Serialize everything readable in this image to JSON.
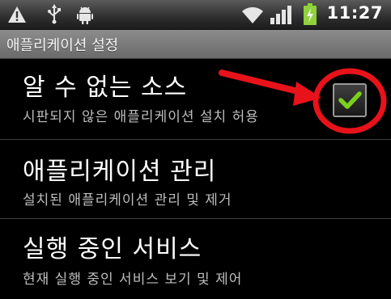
{
  "status_bar": {
    "time": "11:27",
    "icons": [
      "warning-icon",
      "usb-icon",
      "android-debug-icon",
      "wifi-icon",
      "signal-icon",
      "battery-charging-icon"
    ]
  },
  "title_bar": {
    "title": "애플리케이션 설정"
  },
  "settings": [
    {
      "title": "알 수 없는 소스",
      "summary": "시판되지 않은 애플리케이션 설치 허용",
      "checked": true
    },
    {
      "title": "애플리케이션 관리",
      "summary": "설치된 애플리케이션 관리 및 제거"
    },
    {
      "title": "실행 중인 서비스",
      "summary": "현재 실행 중인 서비스 보기 및 제어"
    }
  ],
  "colors": {
    "checkmark": "#7bd11a",
    "annotation": "#e8121a"
  }
}
